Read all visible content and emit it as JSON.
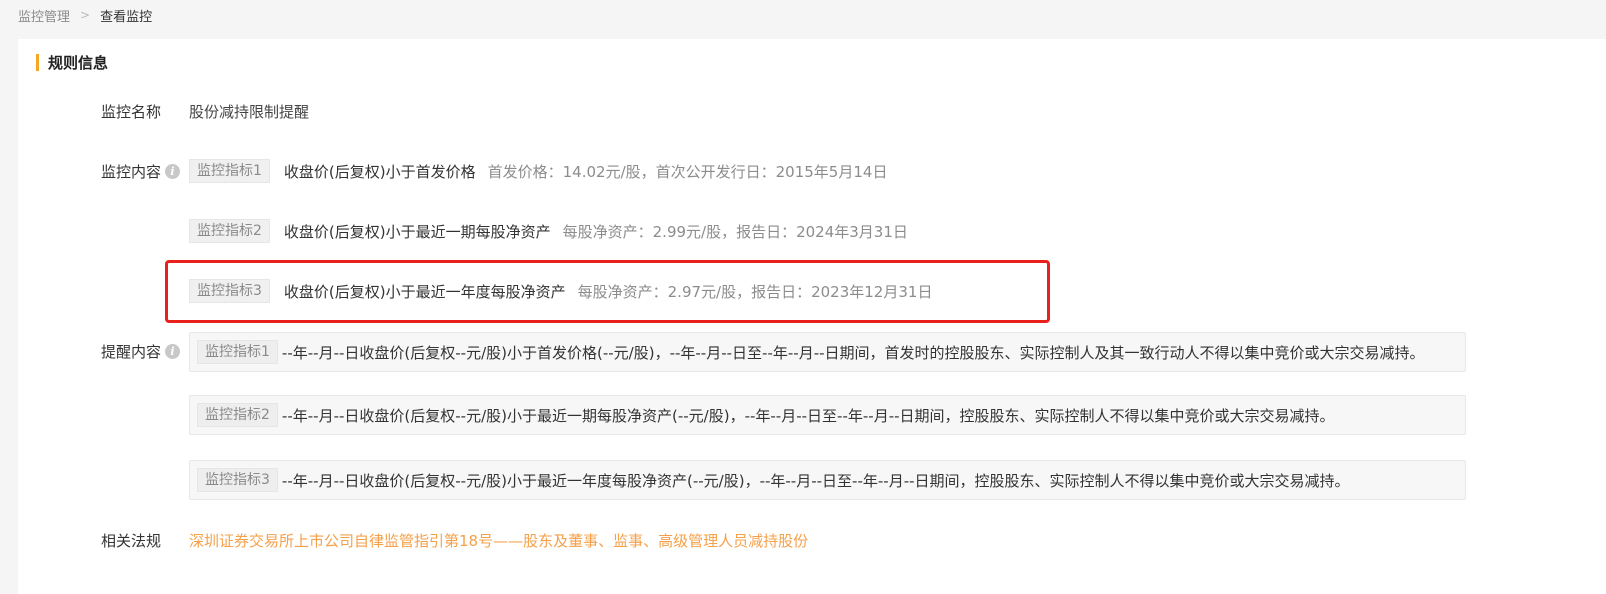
{
  "breadcrumb": {
    "parent": "监控管理",
    "separator": ">",
    "current": "查看监控"
  },
  "section": {
    "title": "规则信息"
  },
  "fields": {
    "name_label": "监控名称",
    "name_value": "股份减持限制提醒",
    "content_label": "监控内容",
    "reminder_label": "提醒内容",
    "law_label": "相关法规",
    "info_icon": "i"
  },
  "monitor_metrics": [
    {
      "tag": "监控指标1",
      "condition": "收盘价(后复权)小于首发价格",
      "detail": "首发价格：14.02元/股，首次公开发行日：2015年5月14日"
    },
    {
      "tag": "监控指标2",
      "condition": "收盘价(后复权)小于最近一期每股净资产",
      "detail": "每股净资产：2.99元/股，报告日：2024年3月31日"
    },
    {
      "tag": "监控指标3",
      "condition": "收盘价(后复权)小于最近一年度每股净资产",
      "detail": "每股净资产：2.97元/股，报告日：2023年12月31日"
    }
  ],
  "reminders": [
    {
      "tag": "监控指标1",
      "text": "--年--月--日收盘价(后复权--元/股)小于首发价格(--元/股)，--年--月--日至--年--月--日期间，首发时的控股股东、实际控制人及其一致行动人不得以集中竞价或大宗交易减持。"
    },
    {
      "tag": "监控指标2",
      "text": "--年--月--日收盘价(后复权--元/股)小于最近一期每股净资产(--元/股)，--年--月--日至--年--月--日期间，控股股东、实际控制人不得以集中竞价或大宗交易减持。"
    },
    {
      "tag": "监控指标3",
      "text": "--年--月--日收盘价(后复权--元/股)小于最近一年度每股净资产(--元/股)，--年--月--日至--年--月--日期间，控股股东、实际控制人不得以集中竞价或大宗交易减持。"
    }
  ],
  "law": {
    "link_text": "深圳证券交易所上市公司自律监管指引第18号——股东及董事、监事、高级管理人员减持股份"
  },
  "colors": {
    "accent": "#f5a623",
    "link": "#f5a04a",
    "highlight": "#e8221b"
  }
}
